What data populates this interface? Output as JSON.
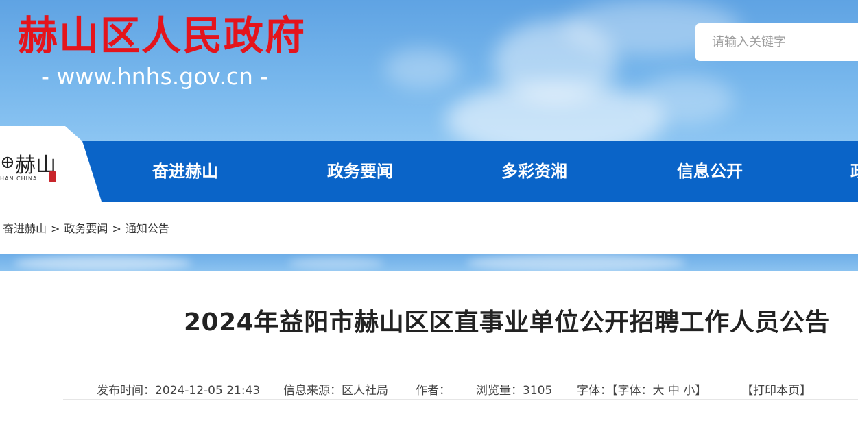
{
  "header": {
    "site_title": "赫山区人民政府",
    "site_url": "- www.hnhs.gov.cn -",
    "search_placeholder": "请输入关键字"
  },
  "logo": {
    "mark": "⊕",
    "name_cn": "赫山",
    "name_en": "HAN  CHINA"
  },
  "nav": {
    "items": [
      {
        "label": "奋进赫山"
      },
      {
        "label": "政务要闻"
      },
      {
        "label": "多彩资湘"
      },
      {
        "label": "信息公开"
      },
      {
        "label": "政"
      }
    ]
  },
  "breadcrumb": {
    "items": [
      "奋进赫山",
      "政务要闻",
      "通知公告"
    ],
    "separator": ">"
  },
  "article": {
    "title": "2024年益阳市赫山区区直事业单位公开招聘工作人员公告",
    "meta": {
      "publish_time": "发布时间：2024-12-05 21:43",
      "source": "信息来源：区人社局",
      "author": "作者：",
      "views": "浏览量：3105",
      "font_label": "字体：【字体：",
      "font_large": "大",
      "font_medium": "中",
      "font_small": "小",
      "font_close": "】",
      "print": "【打印本页】"
    }
  },
  "colors": {
    "title_red": "#e4141c",
    "nav_blue": "#0a64c8",
    "sky_blue": "#6eaee8"
  }
}
